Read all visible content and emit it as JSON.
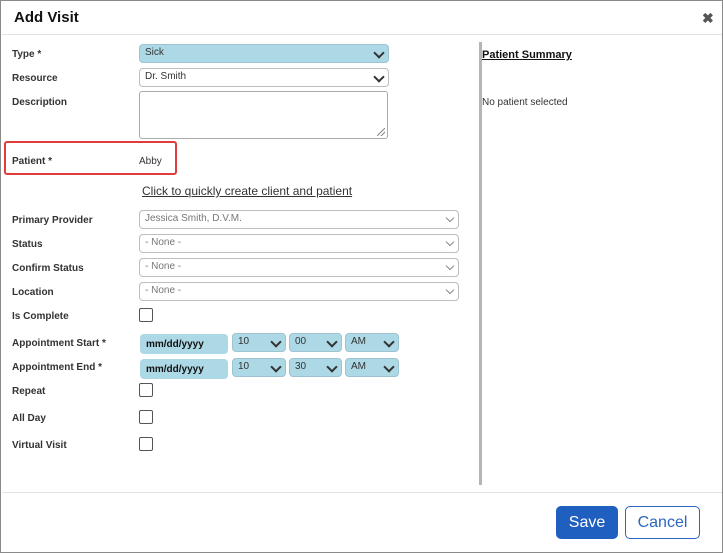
{
  "dialog": {
    "title": "Add Visit"
  },
  "form": {
    "type": {
      "label": "Type *",
      "value": "Sick"
    },
    "resource": {
      "label": "Resource",
      "value": "Dr. Smith"
    },
    "description": {
      "label": "Description",
      "value": ""
    },
    "patient": {
      "label": "Patient *",
      "value": "Abby"
    },
    "create_link": "Click to quickly create client and patient",
    "primary_provider": {
      "label": "Primary Provider",
      "value": "Jessica Smith, D.V.M."
    },
    "status": {
      "label": "Status",
      "value": "- None -"
    },
    "confirm_status": {
      "label": "Confirm Status",
      "value": "- None -"
    },
    "location": {
      "label": "Location",
      "value": "- None -"
    },
    "is_complete": {
      "label": "Is Complete",
      "checked": false
    },
    "appointment_start": {
      "label": "Appointment Start *",
      "date": "mm/dd/yyyy",
      "hour": "10",
      "minute": "00",
      "ampm": "AM"
    },
    "appointment_end": {
      "label": "Appointment End *",
      "date": "mm/dd/yyyy",
      "hour": "10",
      "minute": "30",
      "ampm": "AM"
    },
    "repeat": {
      "label": "Repeat",
      "checked": false
    },
    "all_day": {
      "label": "All Day",
      "checked": false
    },
    "virtual_visit": {
      "label": "Virtual Visit",
      "checked": false
    }
  },
  "summary": {
    "title": "Patient Summary",
    "empty_text": "No patient selected"
  },
  "footer": {
    "save_label": "Save",
    "cancel_label": "Cancel"
  },
  "colors": {
    "accent": "#1f5fbf",
    "field_highlight": "#add8e6",
    "callout": "#e13c3c"
  },
  "icons": {
    "close": "close-icon",
    "dropdown": "chevron-down-icon"
  }
}
